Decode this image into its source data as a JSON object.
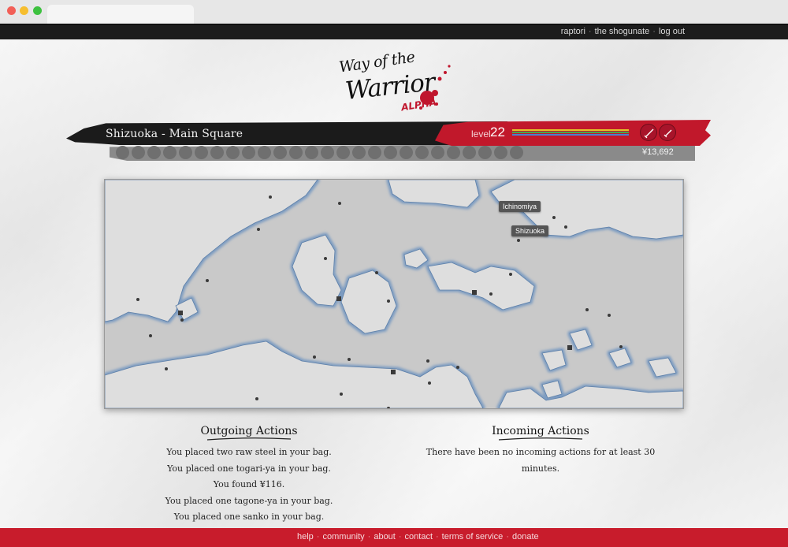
{
  "top_nav": {
    "links": [
      "raptori",
      "the shogunate",
      "log out"
    ],
    "separator": "·"
  },
  "logo": {
    "line1": "Way of the",
    "line2": "Warrior",
    "tag": "ALPHA"
  },
  "status": {
    "location": "Shizuoka - Main Square",
    "level_label": "level",
    "level": "22",
    "money": "¥13,692",
    "bars": [
      {
        "color": "#e3c227",
        "fill": 1.0
      },
      {
        "color": "#48a64a",
        "fill": 1.0
      },
      {
        "color": "#4a7fd0",
        "fill": 1.0
      }
    ],
    "weapon_icons": [
      "katana-icon",
      "wakizashi-icon"
    ],
    "inventory_slot_count": 26
  },
  "map": {
    "labels": [
      "Ichinomiya",
      "Shizuoka"
    ]
  },
  "outgoing": {
    "title": "Outgoing Actions",
    "lines": [
      "You placed two raw steel in your bag.",
      "You placed one togari-ya in your bag.",
      "You found ¥116.",
      "You placed one tagone-ya in your bag.",
      "You placed one sanko in your bag."
    ]
  },
  "incoming": {
    "title": "Incoming Actions",
    "lines": [
      "There have been no incoming actions for at least 30 minutes."
    ]
  },
  "footer": {
    "links": [
      "help",
      "community",
      "about",
      "contact",
      "terms of service",
      "donate"
    ],
    "separator": "·"
  },
  "colors": {
    "brand_red": "#c1182b",
    "topbar": "#1c1c1c"
  }
}
